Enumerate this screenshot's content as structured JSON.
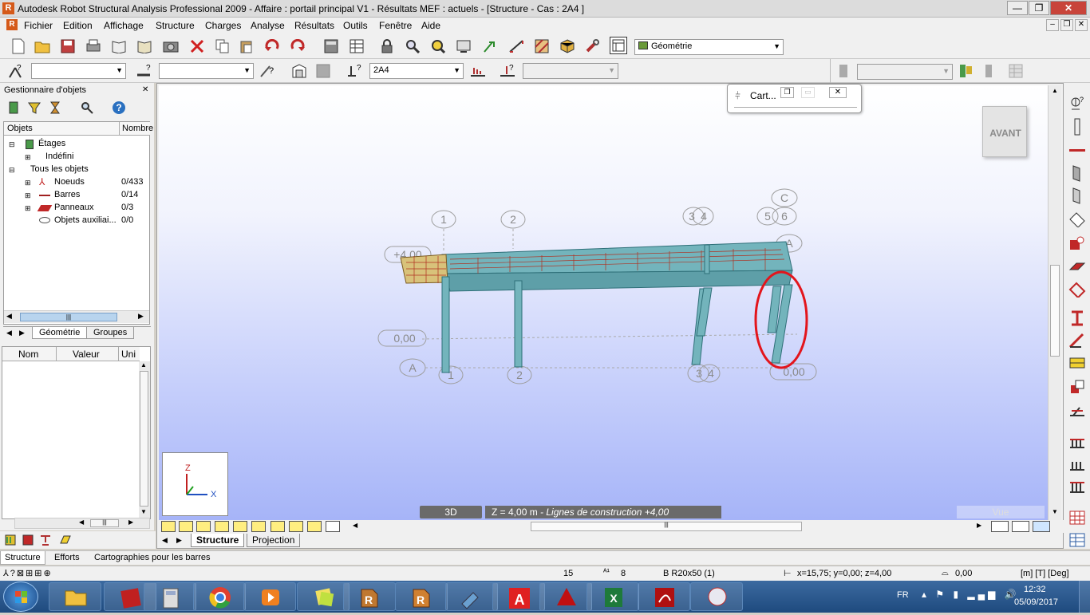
{
  "window": {
    "title": "Autodesk Robot Structural Analysis Professional 2009 - Affaire : portail principal V1 - Résultats MEF : actuels - [Structure - Cas : 2A4  ]"
  },
  "menu": [
    "Fichier",
    "Edition",
    "Affichage",
    "Structure",
    "Charges",
    "Analyse",
    "Résultats",
    "Outils",
    "Fenêtre",
    "Aide"
  ],
  "toolbar": {
    "layout_selector": "Géométrie",
    "load_case": "2A4"
  },
  "object_inspector": {
    "title": "Gestionnaire d'objets",
    "col_objects": "Objets",
    "col_count": "Nombre",
    "tree": [
      {
        "label": "Étages",
        "count": ""
      },
      {
        "label": "Indéfini",
        "count": ""
      },
      {
        "label": "Tous les objets",
        "count": ""
      },
      {
        "label": "Noeuds",
        "count": "0/433"
      },
      {
        "label": "Barres",
        "count": "0/14"
      },
      {
        "label": "Panneaux",
        "count": "0/3"
      },
      {
        "label": "Objets auxiliai...",
        "count": "0/0"
      }
    ],
    "tabs": [
      "Géométrie",
      "Groupes"
    ],
    "props_cols": [
      "Nom",
      "Valeur",
      "Uni"
    ]
  },
  "viewport": {
    "cube_label": "AVANT",
    "map_window_title": "Cart...",
    "gridlines_x": [
      "1",
      "2",
      "3",
      "4",
      "5",
      "6"
    ],
    "gridlines_y": [
      "A",
      "C"
    ],
    "level_label_top": "+4,00",
    "level_label_bottom_left": "0,00",
    "level_label_bottom_right": "0,00",
    "axis_z": "Z",
    "axis_x": "X",
    "view_mode": "3D",
    "plane_info": "Z = 4,00 m",
    "plane_info_italic": " - Lignes de construction +4,00",
    "vue_label": "Vue",
    "highlight_color": "#e3151c",
    "structure_color": "#6fb2ba"
  },
  "bottom_tabs": [
    "Structure",
    "Projection"
  ],
  "result_tabs": [
    "Structure",
    "Efforts",
    "Cartographies pour les barres"
  ],
  "status": {
    "field1": "15",
    "field2": "8",
    "section": "B R20x50 (1)",
    "coords": "x=15,75; y=0,00; z=4,00",
    "angle": "0,00",
    "units": "[m] [T] [Deg]"
  },
  "taskbar": {
    "lang": "FR",
    "time": "12:32",
    "date": "05/09/2017"
  }
}
